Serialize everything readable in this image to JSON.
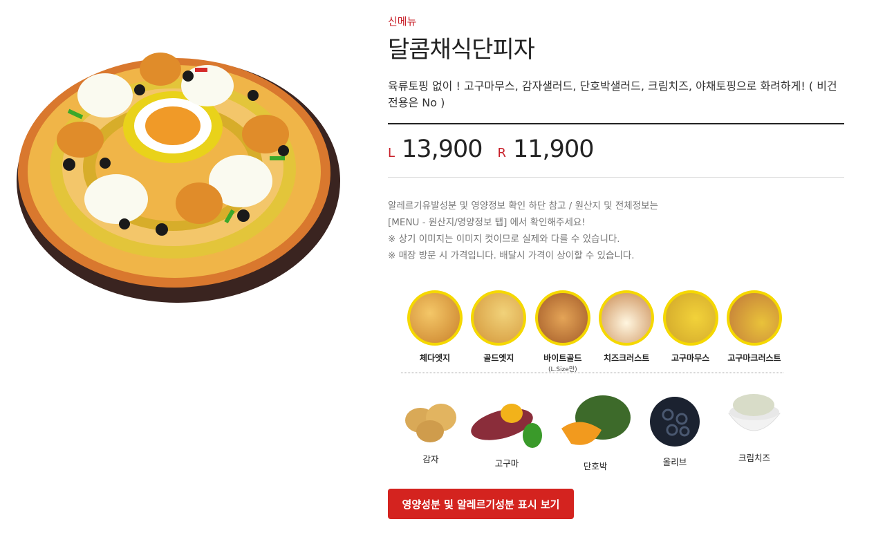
{
  "product": {
    "badge": "신메뉴",
    "name": "달콤채식단피자",
    "description": "육류토핑 없이 ! 고구마무스, 감자샐러드, 단호박샐러드, 크림치즈, 야채토핑으로 화려하게! ( 비건 전용은 No )",
    "prices": [
      {
        "size": "L",
        "amount": "13,900"
      },
      {
        "size": "R",
        "amount": "11,900"
      }
    ],
    "notes": [
      "알레르기유발성분 및 영양정보 확인 하단 참고 / 원산지 및 전체정보는",
      "[MENU - 원산지/영양정보 탭] 에서 확인해주세요!",
      "※ 상기 이미지는 이미지 컷이므로 실제와 다를 수 있습니다.",
      "※ 매장 방문 시 가격입니다. 배달시 가격이 상이할 수 있습니다."
    ]
  },
  "crusts": [
    {
      "label": "체다엣지",
      "sub": ""
    },
    {
      "label": "골드엣지",
      "sub": ""
    },
    {
      "label": "바이트골드",
      "sub": "(L.Size만)"
    },
    {
      "label": "치즈크러스트",
      "sub": ""
    },
    {
      "label": "고구마무스",
      "sub": ""
    },
    {
      "label": "고구마크러스트",
      "sub": ""
    }
  ],
  "toppings": [
    {
      "label": "감자"
    },
    {
      "label": "고구마"
    },
    {
      "label": "단호박"
    },
    {
      "label": "올리브"
    },
    {
      "label": "크림치즈"
    }
  ],
  "actions": {
    "nutrition_button": "영양성분 및 알레르기성분 표시 보기"
  },
  "colors": {
    "accent_red": "#c8202a",
    "button_red": "#d4231f",
    "crust_ring_yellow": "#f5d800"
  }
}
